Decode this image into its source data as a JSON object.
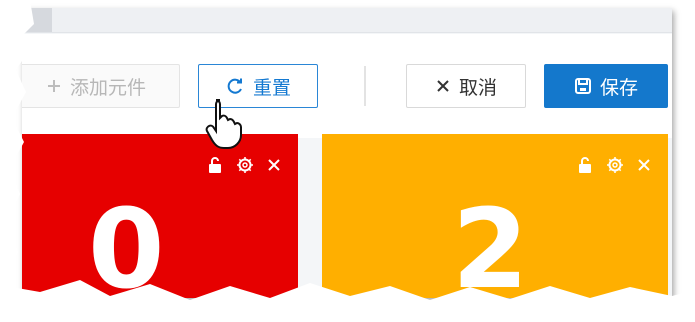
{
  "toolbar": {
    "add_label": "添加元件",
    "reset_label": "重置",
    "cancel_label": "取消",
    "save_label": "保存"
  },
  "cards": [
    {
      "value": "0",
      "color": "#e60000"
    },
    {
      "value": "2",
      "color": "#ffaf00"
    }
  ],
  "icons": {
    "add": "add-icon",
    "reset": "refresh-icon",
    "cancel": "close-icon",
    "save": "save-icon",
    "card_lock": "lock-icon",
    "card_settings": "gear-icon",
    "card_close": "close-icon",
    "cursor": "hand-pointer-icon"
  },
  "colors": {
    "primary": "#1478cc",
    "card_red": "#e60000",
    "card_orange": "#ffaf00"
  }
}
